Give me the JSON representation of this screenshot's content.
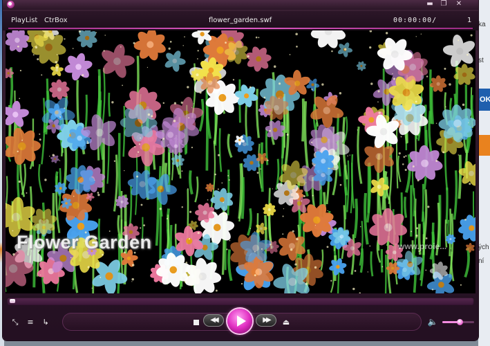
{
  "window": {
    "title_icon": "player-logo-icon",
    "buttons": [
      "minimize",
      "maximize",
      "close"
    ],
    "minimize_glyph": "▬",
    "maximize_glyph": "❐",
    "close_glyph": "✕"
  },
  "menubar": {
    "playlist_label": "PlayList",
    "ctrlbox_label": "CtrBox",
    "file_title": "flower_garden.swf",
    "time": "00:00:00/",
    "list_number": "1",
    "accent_color": "#d44bb8"
  },
  "video": {
    "overlay_title": "Flower Garden",
    "overlay_url": "www.proie..."
  },
  "playback": {
    "progress": 0.0,
    "volume": 0.55
  },
  "controls": {
    "fullscreen_glyph": "⤡",
    "playlist_glyph": "≡",
    "repeat_glyph": "↳",
    "stop_glyph": "",
    "prev_glyph": "◀◀",
    "next_glyph": "▶▶",
    "eject_glyph": "⏏",
    "volume_glyph": "🔈",
    "play_color": "#e12fc2"
  },
  "background": {
    "right_fragments": [
      "ka",
      "st",
      "OK",
      "ých",
      "ní"
    ]
  }
}
